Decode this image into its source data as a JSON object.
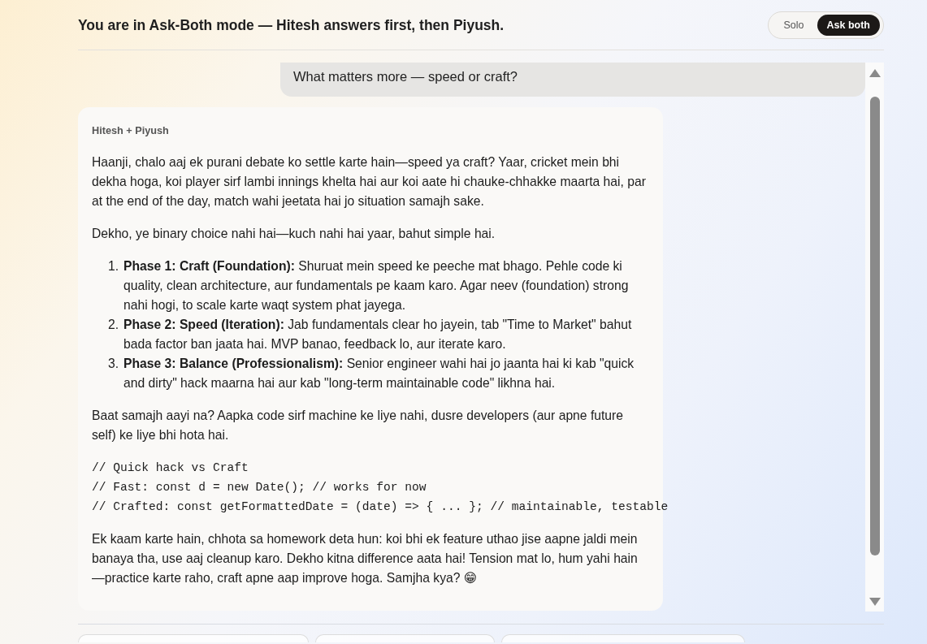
{
  "header": {
    "title": "You are in Ask-Both mode — Hitesh answers first, then Piyush.",
    "mode_toggle": [
      {
        "label": "Solo",
        "selected": false
      },
      {
        "label": "Ask both",
        "selected": true
      }
    ]
  },
  "chat": {
    "user_message": {
      "text": "What matters more — speed or craft?"
    },
    "assistant_message": {
      "author": "Hitesh + Piyush",
      "blocks": [
        {
          "kind": "paragraph",
          "text": "Haanji, chalo aaj ek purani debate ko settle karte hain—speed ya craft? Yaar, cricket mein bhi dekha hoga, koi player sirf lambi innings khelta hai aur koi aate hi chauke-chhakke maarta hai, par at the end of the day, match wahi jeetata hai jo situation samajh sake."
        },
        {
          "kind": "paragraph",
          "text": "Dekho, ye binary choice nahi hai—kuch nahi hai yaar, bahut simple hai."
        },
        {
          "kind": "list",
          "items": [
            {
              "number": "1.",
              "text": "**Phase 1: Craft (Foundation):** Shuruat mein speed ke peeche mat bhago. Pehle code ki quality, clean architecture, aur fundamentals pe kaam karo. Agar neev (foundation) strong nahi hogi, to scale karte waqt system phat jayega."
            },
            {
              "number": "2.",
              "text": "**Phase 2: Speed (Iteration):** Jab fundamentals clear ho jayein, tab \"Time to Market\" bahut bada factor ban jaata hai. MVP banao, feedback lo, aur iterate karo."
            },
            {
              "number": "3.",
              "text": "**Phase 3: Balance (Professionalism):** Senior engineer wahi hai jo jaanta hai ki kab \"quick and dirty\" hack maarna hai aur kab \"long-term maintainable code\" likhna hai."
            }
          ]
        },
        {
          "kind": "paragraph",
          "text": "Baat samajh aayi na? Aapka code sirf machine ke liye nahi, dusre developers (aur apne future self) ke liye bhi hota hai."
        },
        {
          "kind": "code",
          "lines": [
            "// Quick hack vs Craft",
            "// Fast: const d = new Date(); // works for now",
            "// Crafted: const getFormattedDate = (date) => { ... }; // maintainable, testable"
          ]
        },
        {
          "kind": "paragraph",
          "text": "Ek kaam karte hain, chhota sa homework deta hun: koi bhi ek feature uthao jise aapne jaldi mein banaya tha, use aaj cleanup karo. Dekho kitna difference aata hai! Tension mat lo, hum yahi hain—practice karte raho, craft apne aap improve hoga. Samjha kya? 😁"
        }
      ]
    }
  }
}
